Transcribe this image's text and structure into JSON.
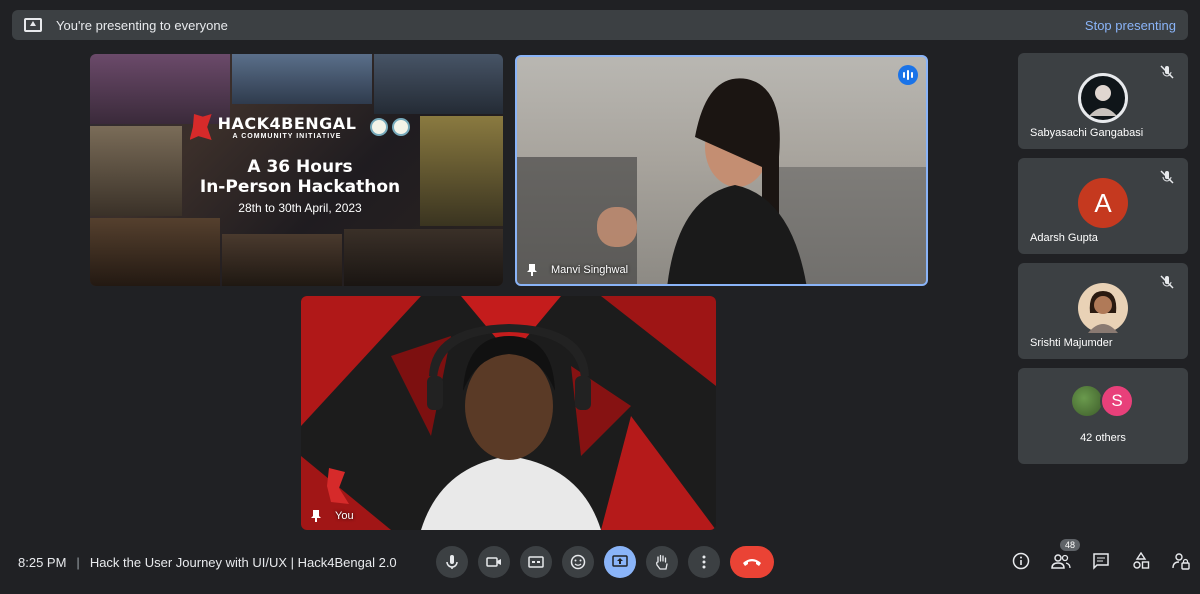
{
  "banner": {
    "message": "You're presenting to everyone",
    "stop_label": "Stop presenting"
  },
  "presentation": {
    "brand": "HACK4BENGAL",
    "tagline": "A COMMUNITY INITIATIVE",
    "title_line1": "A 36 Hours",
    "title_line2": "In-Person Hackathon",
    "dates": "28th to 30th April, 2023"
  },
  "tiles": {
    "speaker_name": "Manvi Singhwal",
    "self_name": "You"
  },
  "participants": [
    {
      "name": "Sabyasachi Gangabasi"
    },
    {
      "name": "Adarsh Gupta",
      "initial": "A"
    },
    {
      "name": "Srishti Majumder"
    }
  ],
  "others": {
    "label": "42 others",
    "initial": "S"
  },
  "bottom": {
    "time": "8:25 PM",
    "meeting_title": "Hack the User Journey with UI/UX | Hack4Bengal 2.0",
    "participant_count": "48"
  },
  "colors": {
    "accent": "#8ab4f8",
    "end_call": "#ea4335",
    "background": "#202124"
  }
}
